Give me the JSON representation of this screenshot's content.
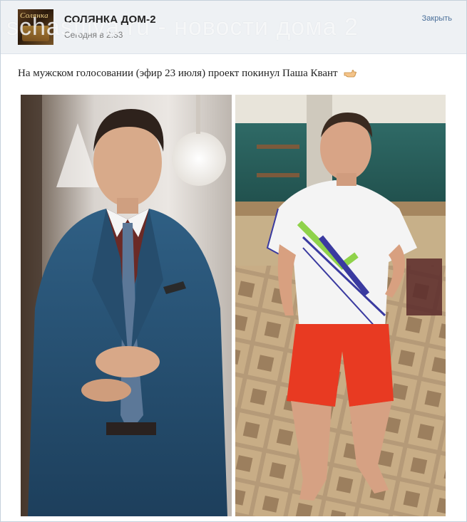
{
  "post": {
    "group_name": "СОЛЯНКА ДОМ-2",
    "time": "Сегодня в 2:33",
    "close_label": "Закрыть",
    "watermark": "schastliva.ru - новости дома 2",
    "text": "На мужском голосовании (эфир 23 июля) проект покинул Паша Квант",
    "avatar_text": "Солянка",
    "icons": {
      "pointing": "pointing-hand-icon"
    }
  },
  "colors": {
    "header_bg": "#eef1f4",
    "link": "#4a6f99",
    "border": "#c5d0db"
  }
}
